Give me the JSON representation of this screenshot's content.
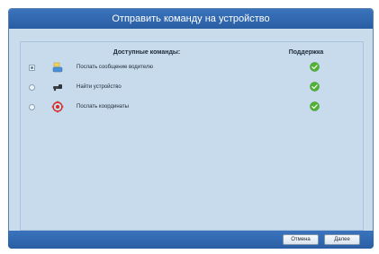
{
  "dialog": {
    "title": "Отправить команду на устройство"
  },
  "table": {
    "header_commands": "Доступные команды:",
    "header_support": "Поддержка",
    "rows": [
      {
        "label": "Послать сообщение водителю",
        "icon": "message-driver-icon",
        "selected": true,
        "supported": true
      },
      {
        "label": "Найти устройство",
        "icon": "find-device-icon",
        "selected": false,
        "supported": true
      },
      {
        "label": "Послать координаты",
        "icon": "target-icon",
        "selected": false,
        "supported": true
      }
    ]
  },
  "footer": {
    "cancel_label": "Отмена",
    "next_label": "Далее"
  },
  "colors": {
    "titlebar": "#2f69b2",
    "dialog_bg": "#c9dcec",
    "supported": "#4fb233"
  }
}
